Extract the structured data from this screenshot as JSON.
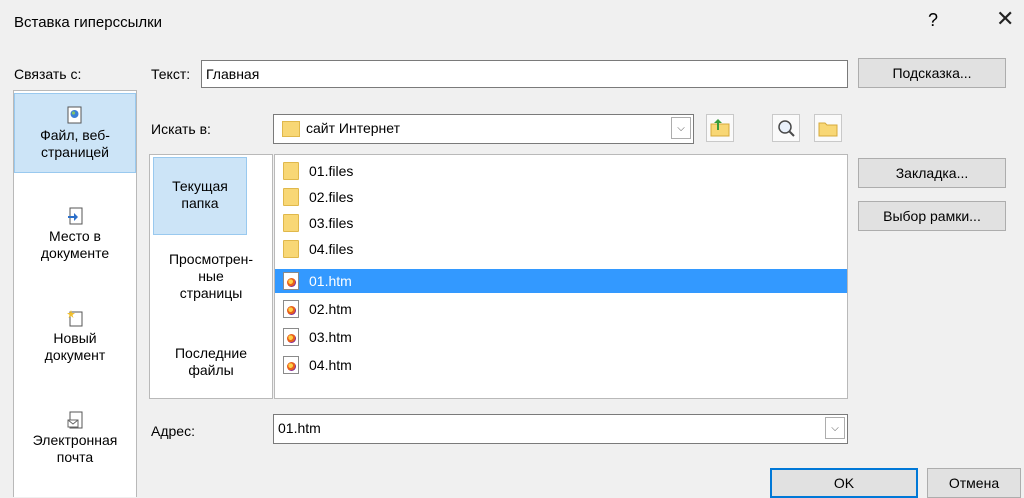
{
  "window": {
    "title": "Вставка гиперссылки",
    "help": "?",
    "close": "✕"
  },
  "left_nav": {
    "label": "Связать с:",
    "items": [
      {
        "line1": "Файл, веб-",
        "line2": "страницей",
        "icon": "file-web-icon",
        "selected": true
      },
      {
        "line1": "Место в",
        "line2": "документе",
        "icon": "place-in-document-icon",
        "selected": false
      },
      {
        "line1": "Новый",
        "line2": "документ",
        "icon": "new-document-icon",
        "selected": false
      },
      {
        "line1": "Электронная",
        "line2": "почта",
        "icon": "email-icon",
        "selected": false
      }
    ]
  },
  "text_field": {
    "label": "Текст:",
    "value": "Главная"
  },
  "hint_button": "Подсказка...",
  "look_in": {
    "label": "Искать в:",
    "value": "сайт Интернет",
    "icons": [
      "up-folder-icon",
      "browse-web-icon",
      "browse-file-icon"
    ]
  },
  "places": [
    {
      "line1": "Текущая",
      "line2": "папка",
      "line3": "",
      "selected": true
    },
    {
      "line1": "Просмотрен-",
      "line2": "ные",
      "line3": "страницы",
      "selected": false
    },
    {
      "line1": "Последние",
      "line2": "файлы",
      "line3": "",
      "selected": false
    }
  ],
  "files": [
    {
      "name": "01.files",
      "type": "folder",
      "selected": false
    },
    {
      "name": "02.files",
      "type": "folder",
      "selected": false
    },
    {
      "name": "03.files",
      "type": "folder",
      "selected": false
    },
    {
      "name": "04.files",
      "type": "folder",
      "selected": false
    },
    {
      "name": "01.htm",
      "type": "htm",
      "selected": true
    },
    {
      "name": "02.htm",
      "type": "htm",
      "selected": false
    },
    {
      "name": "03.htm",
      "type": "htm",
      "selected": false
    },
    {
      "name": "04.htm",
      "type": "htm",
      "selected": false
    }
  ],
  "side_buttons": {
    "bookmark": "Закладка...",
    "frame": "Выбор рамки..."
  },
  "address": {
    "label": "Адрес:",
    "value": "01.htm"
  },
  "footer": {
    "ok": "OK",
    "cancel": "Отмена"
  }
}
